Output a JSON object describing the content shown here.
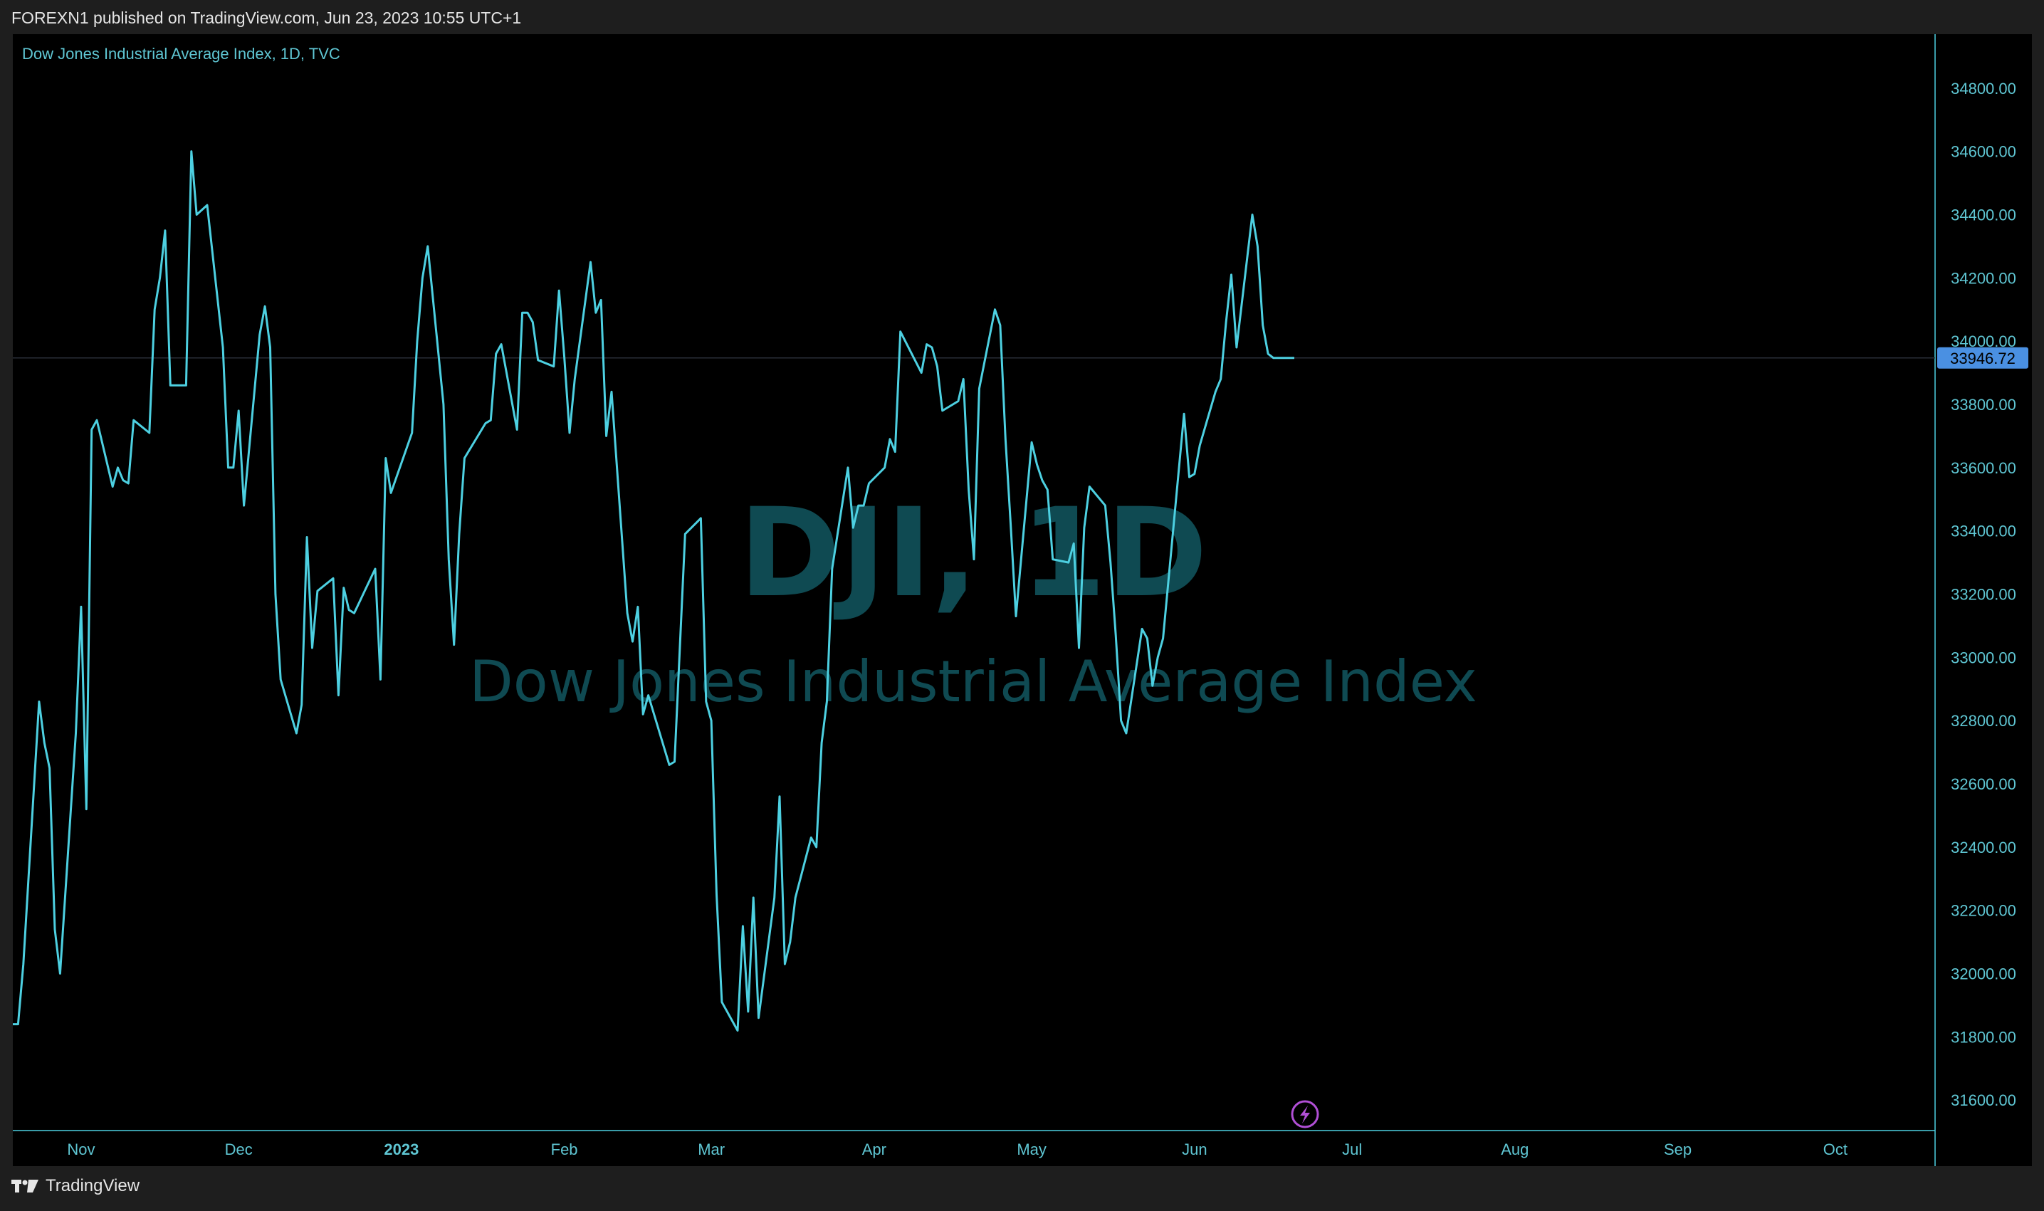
{
  "header": {
    "published_text": "FOREXN1 published on TradingView.com, Jun 23, 2023 10:55 UTC+1"
  },
  "footer": {
    "brand": "TradingView",
    "logo_icon": "tradingview-logo-icon"
  },
  "colors": {
    "line": "#4dd0e1",
    "watermark": "#0f4a52",
    "price_badge": "#4a90e2",
    "axis_text": "#5fc6d3",
    "background": "#000000",
    "frame": "#1e1e1e",
    "lightning": "#b14fd6"
  },
  "chart_data": {
    "type": "line",
    "title": "Dow Jones Industrial Average Index, 1D, TVC",
    "watermark_symbol": "DJI, 1D",
    "watermark_name": "Dow Jones Industrial Average Index",
    "last_price": 33946.72,
    "last_price_label": "33946.72",
    "ylim": [
      31560,
      34840
    ],
    "y_ticks": [
      34800,
      34600,
      34400,
      34200,
      34000,
      33800,
      33600,
      33400,
      33200,
      33000,
      32800,
      32600,
      32400,
      32200,
      32000,
      31800,
      31600
    ],
    "y_tick_labels": [
      "34800.00",
      "34600.00",
      "34400.00",
      "34200.00",
      "34000.00",
      "33800.00",
      "33600.00",
      "33400.00",
      "33200.00",
      "33000.00",
      "32800.00",
      "32600.00",
      "32400.00",
      "32200.00",
      "32000.00",
      "31800.00",
      "31600.00"
    ],
    "x_range": [
      "2022-10-19",
      "2023-10-20"
    ],
    "x_ticks": [
      {
        "label": "Nov",
        "date": "2022-11-01",
        "bold": false
      },
      {
        "label": "Dec",
        "date": "2022-12-01",
        "bold": false
      },
      {
        "label": "2023",
        "date": "2023-01-01",
        "bold": true
      },
      {
        "label": "Feb",
        "date": "2023-02-01",
        "bold": false
      },
      {
        "label": "Mar",
        "date": "2023-03-01",
        "bold": false
      },
      {
        "label": "Apr",
        "date": "2023-04-01",
        "bold": false
      },
      {
        "label": "May",
        "date": "2023-05-01",
        "bold": false
      },
      {
        "label": "Jun",
        "date": "2023-06-01",
        "bold": false
      },
      {
        "label": "Jul",
        "date": "2023-07-01",
        "bold": false
      },
      {
        "label": "Aug",
        "date": "2023-08-01",
        "bold": false
      },
      {
        "label": "Sep",
        "date": "2023-09-01",
        "bold": false
      },
      {
        "label": "Oct",
        "date": "2023-10-01",
        "bold": false
      }
    ],
    "grid": false,
    "series": [
      {
        "values": [
          [
            "2022-10-19",
            31840
          ],
          [
            "2022-10-20",
            31840
          ],
          [
            "2022-10-21",
            32030
          ],
          [
            "2022-10-24",
            32860
          ],
          [
            "2022-10-25",
            32730
          ],
          [
            "2022-10-26",
            32650
          ],
          [
            "2022-10-27",
            32140
          ],
          [
            "2022-10-28",
            32000
          ],
          [
            "2022-10-31",
            32760
          ],
          [
            "2022-11-01",
            33160
          ],
          [
            "2022-11-02",
            32520
          ],
          [
            "2022-11-03",
            33720
          ],
          [
            "2022-11-04",
            33750
          ],
          [
            "2022-11-07",
            33540
          ],
          [
            "2022-11-08",
            33600
          ],
          [
            "2022-11-09",
            33560
          ],
          [
            "2022-11-10",
            33550
          ],
          [
            "2022-11-11",
            33750
          ],
          [
            "2022-11-14",
            33710
          ],
          [
            "2022-11-15",
            34100
          ],
          [
            "2022-11-16",
            34200
          ],
          [
            "2022-11-17",
            34350
          ],
          [
            "2022-11-18",
            33860
          ],
          [
            "2022-11-21",
            33860
          ],
          [
            "2022-11-22",
            34600
          ],
          [
            "2022-11-23",
            34400
          ],
          [
            "2022-11-25",
            34430
          ],
          [
            "2022-11-28",
            33980
          ],
          [
            "2022-11-29",
            33600
          ],
          [
            "2022-11-30",
            33600
          ],
          [
            "2022-12-01",
            33780
          ],
          [
            "2022-12-02",
            33480
          ],
          [
            "2022-12-05",
            34020
          ],
          [
            "2022-12-06",
            34110
          ],
          [
            "2022-12-07",
            33980
          ],
          [
            "2022-12-08",
            33200
          ],
          [
            "2022-12-09",
            32930
          ],
          [
            "2022-12-12",
            32760
          ],
          [
            "2022-12-13",
            32850
          ],
          [
            "2022-12-14",
            33380
          ],
          [
            "2022-12-15",
            33030
          ],
          [
            "2022-12-16",
            33210
          ],
          [
            "2022-12-19",
            33250
          ],
          [
            "2022-12-20",
            32880
          ],
          [
            "2022-12-21",
            33220
          ],
          [
            "2022-12-22",
            33150
          ],
          [
            "2022-12-23",
            33140
          ],
          [
            "2022-12-27",
            33280
          ],
          [
            "2022-12-28",
            32930
          ],
          [
            "2022-12-29",
            33630
          ],
          [
            "2022-12-30",
            33520
          ],
          [
            "2023-01-03",
            33710
          ],
          [
            "2023-01-04",
            34000
          ],
          [
            "2023-01-05",
            34200
          ],
          [
            "2023-01-06",
            34300
          ],
          [
            "2023-01-09",
            33800
          ],
          [
            "2023-01-10",
            33310
          ],
          [
            "2023-01-11",
            33040
          ],
          [
            "2023-01-12",
            33390
          ],
          [
            "2023-01-13",
            33630
          ],
          [
            "2023-01-17",
            33740
          ],
          [
            "2023-01-18",
            33750
          ],
          [
            "2023-01-19",
            33960
          ],
          [
            "2023-01-20",
            33990
          ],
          [
            "2023-01-23",
            33720
          ],
          [
            "2023-01-24",
            34090
          ],
          [
            "2023-01-25",
            34090
          ],
          [
            "2023-01-26",
            34060
          ],
          [
            "2023-01-27",
            33940
          ],
          [
            "2023-01-30",
            33920
          ],
          [
            "2023-01-31",
            34160
          ],
          [
            "2023-02-01",
            33950
          ],
          [
            "2023-02-02",
            33710
          ],
          [
            "2023-02-03",
            33880
          ],
          [
            "2023-02-06",
            34250
          ],
          [
            "2023-02-07",
            34090
          ],
          [
            "2023-02-08",
            34130
          ],
          [
            "2023-02-09",
            33700
          ],
          [
            "2023-02-10",
            33840
          ],
          [
            "2023-02-13",
            33140
          ],
          [
            "2023-02-14",
            33050
          ],
          [
            "2023-02-15",
            33160
          ],
          [
            "2023-02-16",
            32820
          ],
          [
            "2023-02-17",
            32880
          ],
          [
            "2023-02-21",
            32660
          ],
          [
            "2023-02-22",
            32670
          ],
          [
            "2023-02-23",
            33030
          ],
          [
            "2023-02-24",
            33390
          ],
          [
            "2023-02-27",
            33440
          ],
          [
            "2023-02-28",
            32860
          ],
          [
            "2023-03-01",
            32800
          ],
          [
            "2023-03-02",
            32250
          ],
          [
            "2023-03-03",
            31910
          ],
          [
            "2023-03-06",
            31820
          ],
          [
            "2023-03-07",
            32150
          ],
          [
            "2023-03-08",
            31880
          ],
          [
            "2023-03-09",
            32240
          ],
          [
            "2023-03-10",
            31860
          ],
          [
            "2023-03-13",
            32240
          ],
          [
            "2023-03-14",
            32560
          ],
          [
            "2023-03-15",
            32030
          ],
          [
            "2023-03-16",
            32100
          ],
          [
            "2023-03-17",
            32240
          ],
          [
            "2023-03-20",
            32430
          ],
          [
            "2023-03-21",
            32400
          ],
          [
            "2023-03-22",
            32730
          ],
          [
            "2023-03-23",
            32860
          ],
          [
            "2023-03-24",
            33280
          ],
          [
            "2023-03-27",
            33600
          ],
          [
            "2023-03-28",
            33410
          ],
          [
            "2023-03-29",
            33480
          ],
          [
            "2023-03-30",
            33480
          ],
          [
            "2023-03-31",
            33550
          ],
          [
            "2023-04-03",
            33600
          ],
          [
            "2023-04-04",
            33690
          ],
          [
            "2023-04-05",
            33650
          ],
          [
            "2023-04-06",
            34030
          ],
          [
            "2023-04-10",
            33900
          ],
          [
            "2023-04-11",
            33990
          ],
          [
            "2023-04-12",
            33980
          ],
          [
            "2023-04-13",
            33920
          ],
          [
            "2023-04-14",
            33780
          ],
          [
            "2023-04-17",
            33810
          ],
          [
            "2023-04-18",
            33880
          ],
          [
            "2023-04-19",
            33530
          ],
          [
            "2023-04-20",
            33310
          ],
          [
            "2023-04-21",
            33850
          ],
          [
            "2023-04-24",
            34100
          ],
          [
            "2023-04-25",
            34050
          ],
          [
            "2023-04-26",
            33690
          ],
          [
            "2023-04-27",
            33420
          ],
          [
            "2023-04-28",
            33130
          ],
          [
            "2023-05-01",
            33680
          ],
          [
            "2023-05-02",
            33610
          ],
          [
            "2023-05-03",
            33560
          ],
          [
            "2023-05-04",
            33530
          ],
          [
            "2023-05-05",
            33310
          ],
          [
            "2023-05-08",
            33300
          ],
          [
            "2023-05-09",
            33360
          ],
          [
            "2023-05-10",
            33030
          ],
          [
            "2023-05-11",
            33410
          ],
          [
            "2023-05-12",
            33540
          ],
          [
            "2023-05-15",
            33480
          ],
          [
            "2023-05-16",
            33300
          ],
          [
            "2023-05-17",
            33070
          ],
          [
            "2023-05-18",
            32800
          ],
          [
            "2023-05-19",
            32760
          ],
          [
            "2023-05-22",
            33090
          ],
          [
            "2023-05-23",
            33060
          ],
          [
            "2023-05-24",
            32910
          ],
          [
            "2023-05-25",
            33000
          ],
          [
            "2023-05-26",
            33060
          ],
          [
            "2023-05-30",
            33770
          ],
          [
            "2023-05-31",
            33570
          ],
          [
            "2023-06-01",
            33580
          ],
          [
            "2023-06-02",
            33670
          ],
          [
            "2023-06-05",
            33840
          ],
          [
            "2023-06-06",
            33880
          ],
          [
            "2023-06-07",
            34060
          ],
          [
            "2023-06-08",
            34210
          ],
          [
            "2023-06-09",
            33980
          ],
          [
            "2023-06-12",
            34400
          ],
          [
            "2023-06-13",
            34300
          ],
          [
            "2023-06-14",
            34050
          ],
          [
            "2023-06-15",
            33960
          ],
          [
            "2023-06-16",
            33947
          ],
          [
            "2023-06-20",
            33946.72
          ]
        ]
      }
    ]
  }
}
